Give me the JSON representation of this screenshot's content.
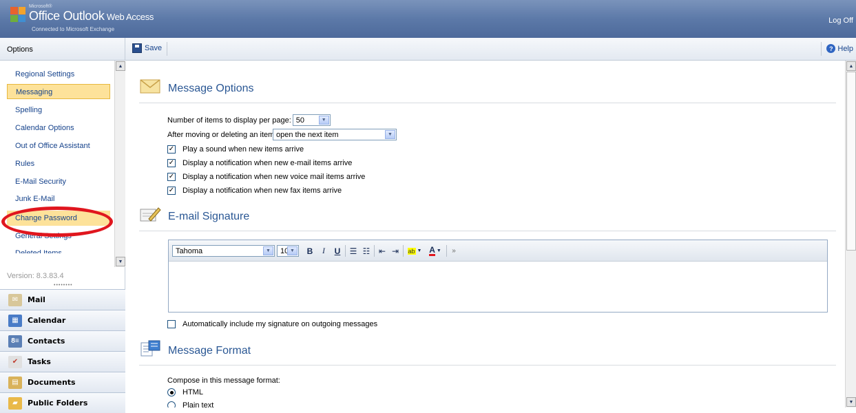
{
  "header": {
    "ms_label": "Microsoft®",
    "product_name": "Office Outlook",
    "product_suffix": " Web Access",
    "connected": "Connected to Microsoft Exchange",
    "logoff": "Log Off"
  },
  "left_nav": {
    "title": "Options",
    "items": [
      "Regional Settings",
      "Messaging",
      "Spelling",
      "Calendar Options",
      "Out of Office Assistant",
      "Rules",
      "E-Mail Security",
      "Junk E-Mail",
      "Change Password",
      "General Settings",
      "Deleted Items"
    ],
    "selected": "Messaging",
    "version": "Version: 8.3.83.4",
    "modules": [
      "Mail",
      "Calendar",
      "Contacts",
      "Tasks",
      "Documents",
      "Public Folders"
    ]
  },
  "toolbar": {
    "save_label": "Save",
    "help_label": "Help"
  },
  "message_options": {
    "title": "Message Options",
    "items_per_page_label": "Number of items to display per page:",
    "items_per_page_value": "50",
    "after_moving_label": "After moving or deleting an item:",
    "after_moving_value": "open the next item",
    "checkboxes": [
      {
        "label": "Play a sound when new items arrive",
        "checked": true
      },
      {
        "label": "Display a notification when new e-mail items arrive",
        "checked": true
      },
      {
        "label": "Display a notification when new voice mail items arrive",
        "checked": true
      },
      {
        "label": "Display a notification when new fax items arrive",
        "checked": true
      }
    ]
  },
  "email_signature": {
    "title": "E-mail Signature",
    "font": "Tahoma",
    "size": "10",
    "auto_include_label": "Automatically include my signature on outgoing messages",
    "auto_include_checked": false
  },
  "message_format": {
    "title": "Message Format",
    "compose_label": "Compose in this message format:",
    "options": [
      {
        "label": "HTML",
        "selected": true
      },
      {
        "label": "Plain text",
        "selected": false
      }
    ]
  },
  "colors": {
    "link": "#15428b",
    "section_title": "#2a5794",
    "highlight": "#fde29a",
    "annotation": "#e0161e"
  }
}
